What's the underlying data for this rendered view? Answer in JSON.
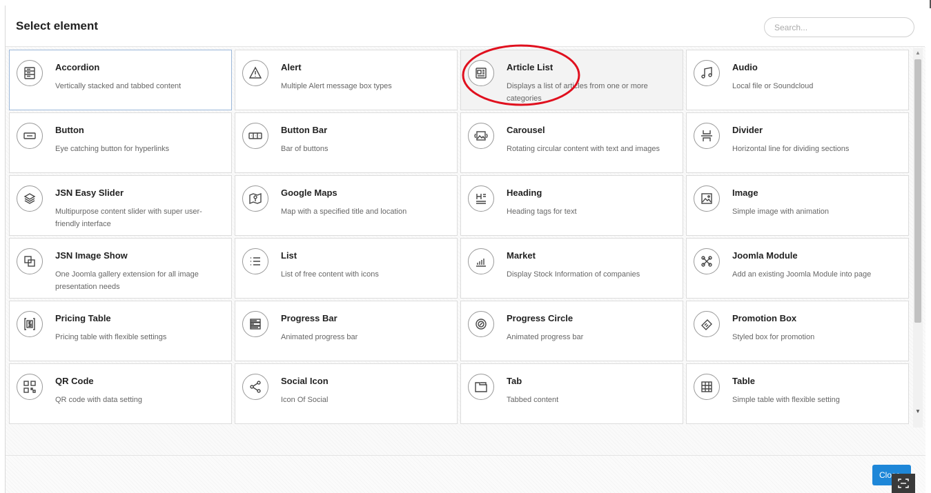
{
  "modal": {
    "title": "Select element",
    "search_placeholder": "Search...",
    "close_label": "Close"
  },
  "elements": [
    {
      "name": "Accordion",
      "desc": "Vertically stacked and tabbed content",
      "icon": "accordion-icon"
    },
    {
      "name": "Alert",
      "desc": "Multiple Alert message box types",
      "icon": "alert-icon"
    },
    {
      "name": "Article List",
      "desc": "Displays a list of articles from one or more categories",
      "icon": "article-list-icon"
    },
    {
      "name": "Audio",
      "desc": "Local file or Soundcloud",
      "icon": "audio-icon"
    },
    {
      "name": "Button",
      "desc": "Eye catching button for hyperlinks",
      "icon": "button-icon"
    },
    {
      "name": "Button Bar",
      "desc": "Bar of buttons",
      "icon": "button-bar-icon"
    },
    {
      "name": "Carousel",
      "desc": "Rotating circular content with text and images",
      "icon": "carousel-icon"
    },
    {
      "name": "Divider",
      "desc": "Horizontal line for dividing sections",
      "icon": "divider-icon"
    },
    {
      "name": "JSN Easy Slider",
      "desc": "Multipurpose content slider with super user-friendly interface",
      "icon": "slider-icon"
    },
    {
      "name": "Google Maps",
      "desc": "Map with a specified title and location",
      "icon": "map-icon"
    },
    {
      "name": "Heading",
      "desc": "Heading tags for text",
      "icon": "heading-icon"
    },
    {
      "name": "Image",
      "desc": "Simple image with animation",
      "icon": "image-icon"
    },
    {
      "name": "JSN Image Show",
      "desc": "One Joomla gallery extension for all image presentation needs",
      "icon": "image-show-icon"
    },
    {
      "name": "List",
      "desc": "List of free content with icons",
      "icon": "list-icon"
    },
    {
      "name": "Market",
      "desc": "Display Stock Information of companies",
      "icon": "market-icon"
    },
    {
      "name": "Joomla Module",
      "desc": "Add an existing Joomla Module into page",
      "icon": "joomla-icon"
    },
    {
      "name": "Pricing Table",
      "desc": "Pricing table with flexible settings",
      "icon": "pricing-icon"
    },
    {
      "name": "Progress Bar",
      "desc": "Animated progress bar",
      "icon": "progress-bar-icon"
    },
    {
      "name": "Progress Circle",
      "desc": "Animated progress bar",
      "icon": "progress-circle-icon"
    },
    {
      "name": "Promotion Box",
      "desc": "Styled box for promotion",
      "icon": "promotion-icon"
    },
    {
      "name": "QR Code",
      "desc": "QR code with data setting",
      "icon": "qr-code-icon"
    },
    {
      "name": "Social Icon",
      "desc": "Icon Of Social",
      "icon": "share-icon"
    },
    {
      "name": "Tab",
      "desc": "Tabbed content",
      "icon": "tab-icon"
    },
    {
      "name": "Table",
      "desc": "Simple table with flexible setting",
      "icon": "table-icon"
    }
  ],
  "state": {
    "selected": "Accordion",
    "hovered": "Article List",
    "highlighted": "Article List"
  },
  "colors": {
    "primary_button": "#1e87d8",
    "annotation": "#e0101e",
    "selected_border": "#9bb7d9"
  }
}
